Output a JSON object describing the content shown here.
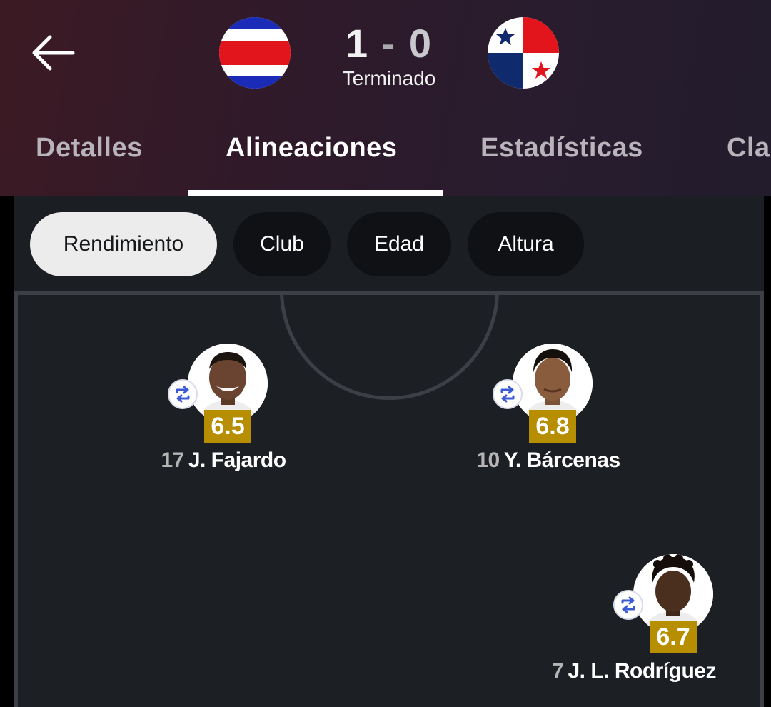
{
  "match": {
    "home_score": "1",
    "separator": "-",
    "away_score": "0",
    "status": "Terminado",
    "home_flag": "costa-rica-flag",
    "away_flag": "panama-flag"
  },
  "tabs": [
    {
      "label": "Detalles"
    },
    {
      "label": "Alineaciones"
    },
    {
      "label": "Estadísticas"
    },
    {
      "label": "Cla"
    }
  ],
  "active_tab": "Alineaciones",
  "filters": [
    {
      "label": "Rendimiento"
    },
    {
      "label": "Club"
    },
    {
      "label": "Edad"
    },
    {
      "label": "Altura"
    }
  ],
  "active_filter": "Rendimiento",
  "players": [
    {
      "number": "17",
      "name": "J. Fajardo",
      "rating": "6.5",
      "substituted": true
    },
    {
      "number": "10",
      "name": "Y. Bárcenas",
      "rating": "6.8",
      "substituted": true
    },
    {
      "number": "7",
      "name": "J. L. Rodríguez",
      "rating": "6.7",
      "substituted": true
    }
  ],
  "colors": {
    "rating_badge": "#b68e00",
    "pitch": "#1c1f23",
    "pitch_lines": "#3c4046",
    "active_chip": "#ececec"
  }
}
